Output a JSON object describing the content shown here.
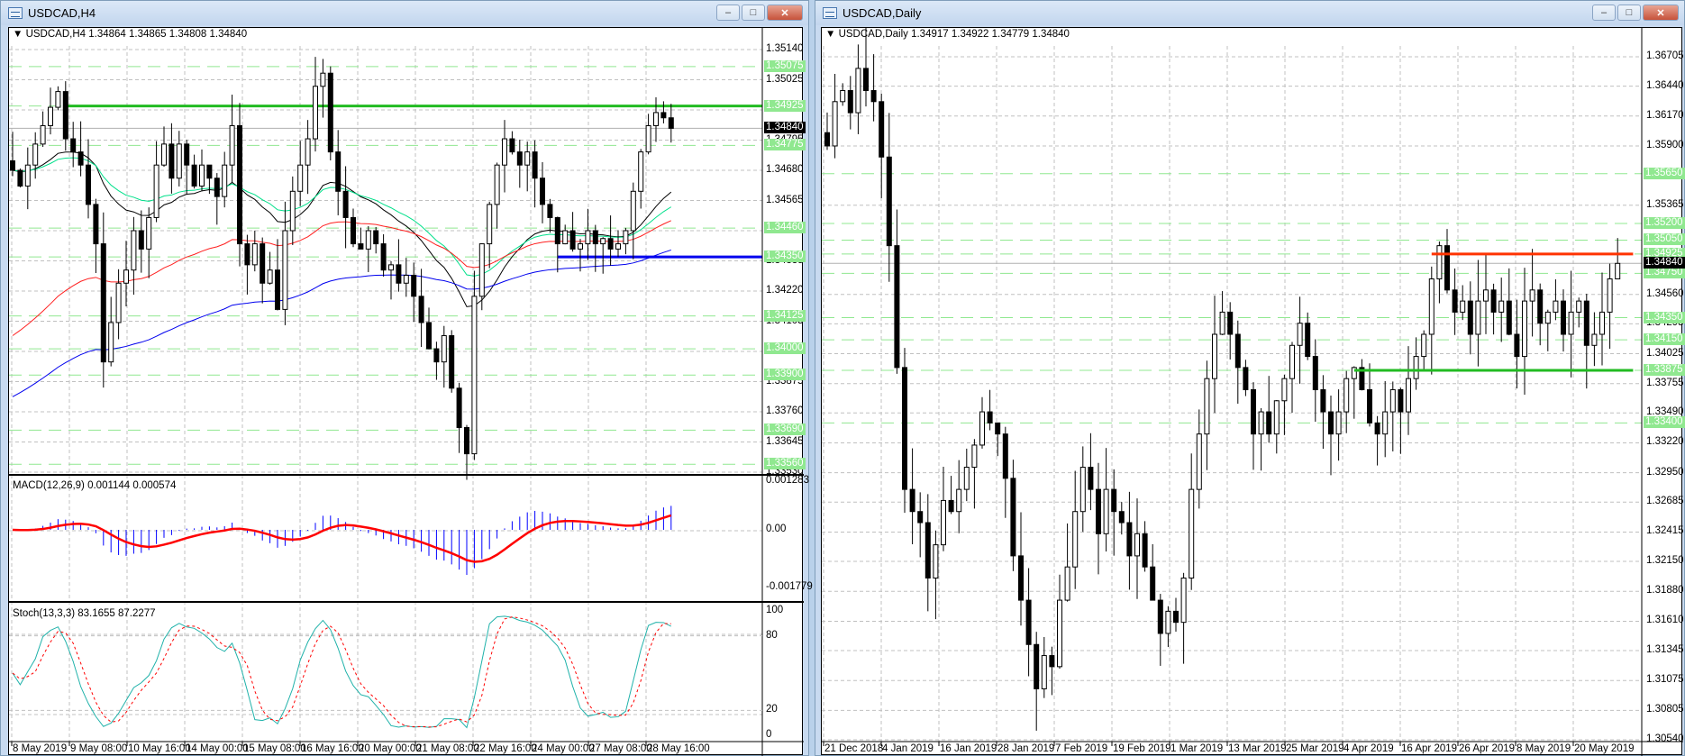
{
  "left_window": {
    "title": "USDCAD,H4",
    "info": "USDCAD,H4  1.34864 1.34865 1.34808 1.34840",
    "price_labels": [
      "1.35140",
      "1.35025",
      "1.34910",
      "1.34795",
      "1.34680",
      "1.34565",
      "1.34450",
      "1.34335",
      "1.34220",
      "1.34105",
      "1.33990",
      "1.33875",
      "1.33760",
      "1.33645",
      "1.33530"
    ],
    "level_labels": [
      "1.35075",
      "1.34925",
      "1.34775",
      "1.34460",
      "1.34350",
      "1.34125",
      "1.34000",
      "1.33900",
      "1.33690",
      "1.33560"
    ],
    "current_price": "1.34840",
    "macd": {
      "label": "MACD(12,26,9) 0.001144 0.000574",
      "axis": [
        "0.001283",
        "0.00",
        "-0.001779"
      ]
    },
    "stoch": {
      "label": "Stoch(13,3,3) 83.1655 87.2277",
      "axis": [
        "100",
        "80",
        "20",
        "0"
      ]
    },
    "dates": [
      "8 May 2019",
      "9 May 08:00",
      "10 May 16:00",
      "14 May 00:00",
      "15 May 08:00",
      "16 May 16:00",
      "20 May 00:00",
      "21 May 08:00",
      "22 May 16:00",
      "24 May 00:00",
      "27 May 08:00",
      "28 May 16:00"
    ]
  },
  "right_window": {
    "title": "USDCAD,Daily",
    "info": "USDCAD,Daily  1.34917 1.34922 1.34779 1.34840",
    "price_labels": [
      "1.36705",
      "1.36440",
      "1.36170",
      "1.35900",
      "1.35365",
      "1.34560",
      "1.34295",
      "1.34025",
      "1.33755",
      "1.33490",
      "1.33220",
      "1.32950",
      "1.32685",
      "1.32415",
      "1.32150",
      "1.31880",
      "1.31610",
      "1.31345",
      "1.31075",
      "1.30805",
      "1.30540"
    ],
    "level_labels": [
      "1.35650",
      "1.35200",
      "1.35050",
      "1.34925",
      "1.34750",
      "1.34350",
      "1.34150",
      "1.33875",
      "1.33400"
    ],
    "current_price": "1.34840",
    "dates": [
      "21 Dec 2018",
      "4 Jan 2019",
      "16 Jan 2019",
      "28 Jan 2019",
      "7 Feb 2019",
      "19 Feb 2019",
      "1 Mar 2019",
      "13 Mar 2019",
      "25 Mar 2019",
      "4 Apr 2019",
      "16 Apr 2019",
      "26 Apr 2019",
      "8 May 2019",
      "20 May 2019"
    ]
  },
  "colors": {
    "bull": "#ffffff",
    "bear": "#000000",
    "level": "#90e890",
    "support": "#22bb22",
    "resistance_h4_low": "#0000ee",
    "resistance_daily": "#ff3300",
    "macd_hist": "#0000ff",
    "macd_signal": "#ff0000",
    "stoch_main": "#20b2aa",
    "stoch_signal": "#ff0000"
  },
  "chart_data": [
    {
      "type": "candlestick",
      "title": "USDCAD,H4",
      "ylim": [
        1.3353,
        1.3514
      ],
      "closes": [
        1.3468,
        1.3462,
        1.347,
        1.3478,
        1.3485,
        1.3492,
        1.3498,
        1.348,
        1.3475,
        1.347,
        1.3455,
        1.344,
        1.3395,
        1.341,
        1.3425,
        1.343,
        1.3445,
        1.3438,
        1.345,
        1.347,
        1.3478,
        1.3465,
        1.3478,
        1.347,
        1.3462,
        1.347,
        1.3465,
        1.3458,
        1.347,
        1.3485,
        1.344,
        1.3432,
        1.344,
        1.3425,
        1.343,
        1.3415,
        1.3445,
        1.346,
        1.347,
        1.348,
        1.35,
        1.3505,
        1.3475,
        1.346,
        1.345,
        1.344,
        1.3438,
        1.3445,
        1.344,
        1.343,
        1.3432,
        1.3425,
        1.3428,
        1.342,
        1.341,
        1.34,
        1.3395,
        1.3405,
        1.3385,
        1.337,
        1.336,
        1.342,
        1.344,
        1.3455,
        1.347,
        1.348,
        1.3475,
        1.347,
        1.3475,
        1.3465,
        1.3455,
        1.345,
        1.344,
        1.3445,
        1.3438,
        1.344,
        1.3445,
        1.344,
        1.3442,
        1.3438,
        1.344,
        1.3445,
        1.346,
        1.3475,
        1.3485,
        1.349,
        1.3488,
        1.3484
      ],
      "lines": {
        "support": 1.34925,
        "blue": 1.3435
      }
    },
    {
      "type": "candlestick",
      "title": "USDCAD,Daily",
      "ylim": [
        1.3054,
        1.36705
      ],
      "closes": [
        1.359,
        1.363,
        1.364,
        1.362,
        1.366,
        1.364,
        1.363,
        1.358,
        1.35,
        1.339,
        1.328,
        1.326,
        1.325,
        1.32,
        1.323,
        1.327,
        1.326,
        1.328,
        1.33,
        1.332,
        1.335,
        1.334,
        1.333,
        1.329,
        1.322,
        1.318,
        1.314,
        1.31,
        1.313,
        1.312,
        1.318,
        1.321,
        1.326,
        1.33,
        1.328,
        1.324,
        1.328,
        1.326,
        1.325,
        1.322,
        1.324,
        1.321,
        1.318,
        1.315,
        1.317,
        1.316,
        1.32,
        1.328,
        1.333,
        1.338,
        1.342,
        1.344,
        1.342,
        1.339,
        1.337,
        1.333,
        1.335,
        1.333,
        1.336,
        1.338,
        1.341,
        1.343,
        1.34,
        1.337,
        1.335,
        1.333,
        1.335,
        1.338,
        1.339,
        1.337,
        1.334,
        1.333,
        1.335,
        1.337,
        1.335,
        1.338,
        1.34,
        1.342,
        1.347,
        1.35,
        1.346,
        1.344,
        1.345,
        1.342,
        1.345,
        1.346,
        1.344,
        1.345,
        1.342,
        1.34,
        1.345,
        1.346,
        1.343,
        1.344,
        1.345,
        1.342,
        1.344,
        1.345,
        1.341,
        1.342,
        1.344,
        1.347,
        1.3484
      ],
      "lines": {
        "resistance": 1.34925,
        "support": 1.33875
      }
    }
  ]
}
